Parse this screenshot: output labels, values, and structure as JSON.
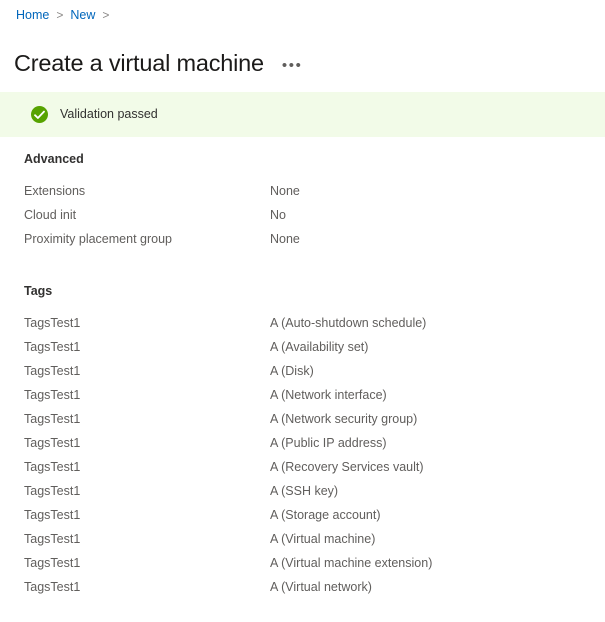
{
  "breadcrumb": {
    "items": [
      {
        "label": "Home"
      },
      {
        "label": "New"
      }
    ],
    "separator": ">"
  },
  "header": {
    "title": "Create a virtual machine",
    "more_menu_label": "•••"
  },
  "banner": {
    "status": "success",
    "text": "Validation passed",
    "icon": "check-circle-icon",
    "background_color": "#f2fbe8",
    "icon_color": "#57a300"
  },
  "sections": [
    {
      "id": "advanced",
      "heading": "Advanced",
      "rows": [
        {
          "key": "Extensions",
          "value": "None"
        },
        {
          "key": "Cloud init",
          "value": "No"
        },
        {
          "key": "Proximity placement group",
          "value": "None"
        }
      ]
    },
    {
      "id": "tags",
      "heading": "Tags",
      "rows": [
        {
          "key": "TagsTest1",
          "value": "A (Auto-shutdown schedule)"
        },
        {
          "key": "TagsTest1",
          "value": "A (Availability set)"
        },
        {
          "key": "TagsTest1",
          "value": "A (Disk)"
        },
        {
          "key": "TagsTest1",
          "value": "A (Network interface)"
        },
        {
          "key": "TagsTest1",
          "value": "A (Network security group)"
        },
        {
          "key": "TagsTest1",
          "value": "A (Public IP address)"
        },
        {
          "key": "TagsTest1",
          "value": "A (Recovery Services vault)"
        },
        {
          "key": "TagsTest1",
          "value": "A (SSH key)"
        },
        {
          "key": "TagsTest1",
          "value": "A (Storage account)"
        },
        {
          "key": "TagsTest1",
          "value": "A (Virtual machine)"
        },
        {
          "key": "TagsTest1",
          "value": "A (Virtual machine extension)"
        },
        {
          "key": "TagsTest1",
          "value": "A (Virtual network)"
        }
      ]
    }
  ],
  "colors": {
    "link": "#0066bb",
    "text_primary": "#323130",
    "text_secondary": "#605e5c",
    "success": "#57a300",
    "success_background": "#f2fbe8"
  }
}
